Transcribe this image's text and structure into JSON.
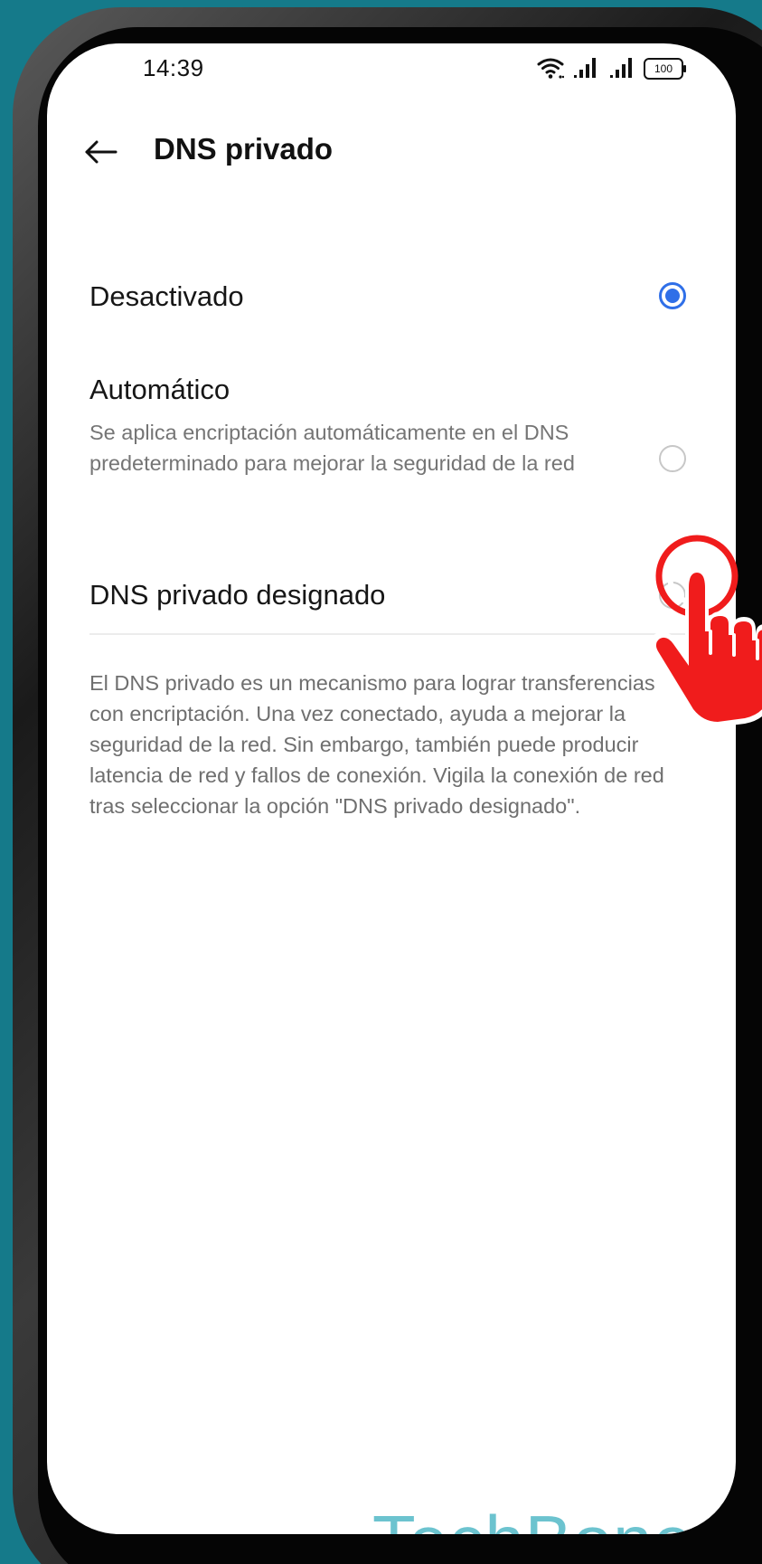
{
  "status_bar": {
    "time": "14:39",
    "battery": "100"
  },
  "header": {
    "title": "DNS privado"
  },
  "options": [
    {
      "title": "Desactivado",
      "description": "",
      "selected": true
    },
    {
      "title": "Automático",
      "description": "Se aplica encriptación automáticamente en el DNS predeterminado para mejorar la seguridad de la red",
      "selected": false
    },
    {
      "title": "DNS privado designado",
      "description": "",
      "selected": false
    }
  ],
  "info": {
    "text": "El DNS privado es un mecanismo para lograr transferencias con encriptación. Una vez conectado, ayuda a mejorar la seguridad de la red. Sin embargo, también puede producir latencia de red y fallos de conexión. Vigila la conexión de red tras seleccionar la opción \"DNS privado designado\"."
  },
  "watermark": "TechBone",
  "colors": {
    "accent": "#2f6fe8",
    "background": "#157a8a",
    "watermark": "#6cc3cf",
    "tap_indicator": "#f01c1c"
  },
  "icons": {
    "back": "arrow-left-icon",
    "wifi": "wifi-icon",
    "signal": "cellular-signal-icon",
    "battery": "battery-icon",
    "tap": "tap-hand-icon"
  }
}
